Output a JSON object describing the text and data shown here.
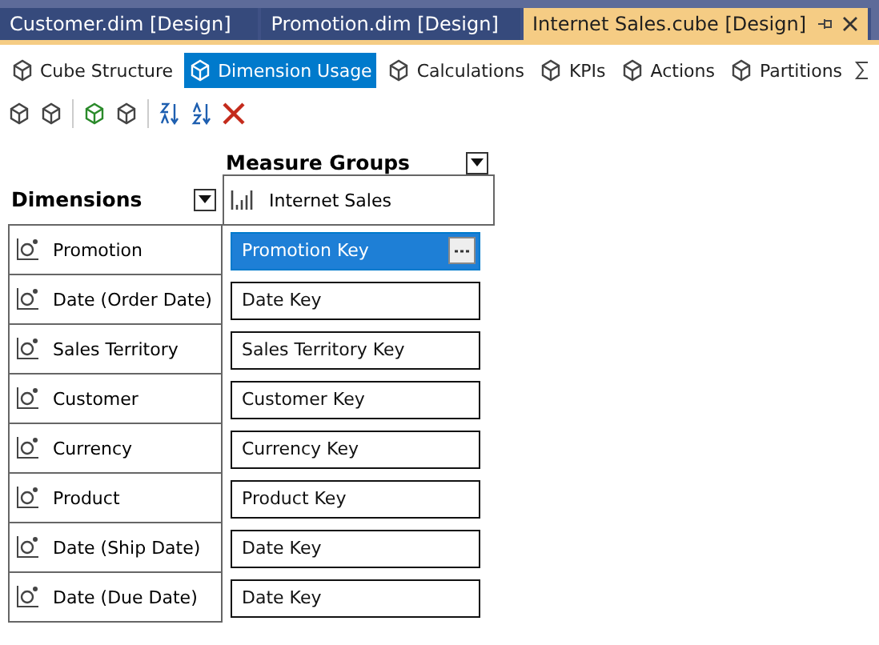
{
  "doc_tabs": [
    {
      "label": "Customer.dim [Design]",
      "selected": false
    },
    {
      "label": "Promotion.dim [Design]",
      "selected": false
    },
    {
      "label": "Internet Sales.cube [Design]",
      "selected": true
    }
  ],
  "designer_tabs": [
    {
      "label": "Cube Structure",
      "selected": false
    },
    {
      "label": "Dimension Usage",
      "selected": true
    },
    {
      "label": "Calculations",
      "selected": false
    },
    {
      "label": "KPIs",
      "selected": false
    },
    {
      "label": "Actions",
      "selected": false
    },
    {
      "label": "Partitions",
      "selected": false
    }
  ],
  "grid": {
    "measure_groups_title": "Measure Groups",
    "dimensions_title": "Dimensions",
    "measure_group": "Internet Sales",
    "rows": [
      {
        "dimension": "Promotion",
        "key": "Promotion Key",
        "selected": true
      },
      {
        "dimension": "Date (Order Date)",
        "key": "Date Key",
        "selected": false
      },
      {
        "dimension": "Sales Territory",
        "key": "Sales Territory Key",
        "selected": false
      },
      {
        "dimension": "Customer",
        "key": "Customer Key",
        "selected": false
      },
      {
        "dimension": "Currency",
        "key": "Currency Key",
        "selected": false
      },
      {
        "dimension": "Product",
        "key": "Product Key",
        "selected": false
      },
      {
        "dimension": "Date (Ship Date)",
        "key": "Date Key",
        "selected": false
      },
      {
        "dimension": "Date (Due Date)",
        "key": "Date Key",
        "selected": false
      }
    ]
  }
}
